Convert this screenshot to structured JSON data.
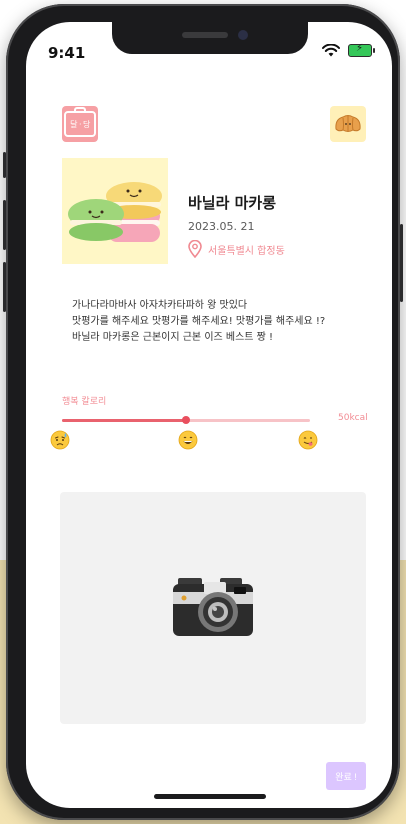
{
  "status_bar": {
    "time": "9:41"
  },
  "header": {
    "logo_text": "달 · 당"
  },
  "food": {
    "name": "바닐라 마카롱",
    "date": "2023.05. 21",
    "location": "서울특별시 합정동"
  },
  "review": {
    "lines": [
      "가나다라마바사 아자차카타파하 왕 맛있다",
      "맛평가를 해주세요 맛평가를 해주세요! 맛평가를 해주세요 !?",
      "바닐라 마카롱은 근본이지 근본 이즈 베스트 짱 !"
    ]
  },
  "calorie_slider": {
    "label": "행복 칼로리",
    "max_label": "50kcal",
    "value_fraction": 0.5,
    "emojis": [
      "sad-sweat-face",
      "grinning-face",
      "yummy-face"
    ]
  },
  "photo_upload": {
    "icon": "camera-icon"
  },
  "actions": {
    "done_label": "완료 !"
  },
  "colors": {
    "accent_pink": "#f08a92",
    "slider_red": "#e9626e",
    "done_purple": "#dcc6ff",
    "logo_pink": "#f6a0a4"
  }
}
